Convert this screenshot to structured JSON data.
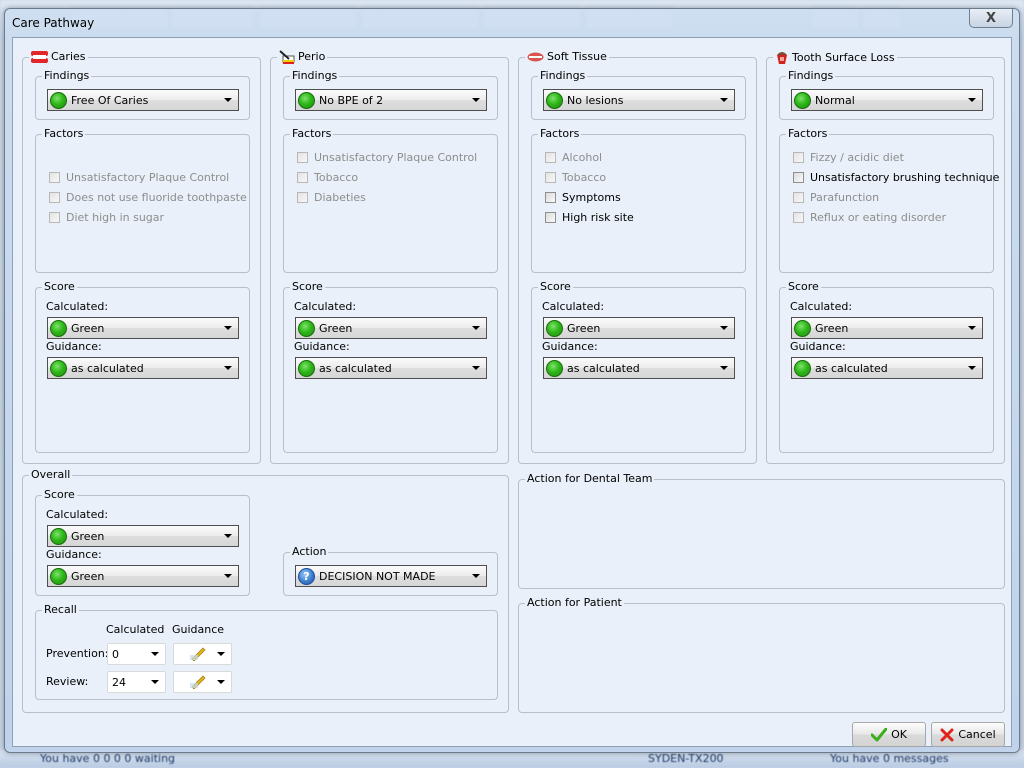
{
  "background": {
    "status_left": "You have 0 0 0 0 waiting",
    "status_mid": "SYDEN-TX200",
    "status_right": "You have 0 messages"
  },
  "dialog": {
    "title": "Care Pathway",
    "close_glyph": "X"
  },
  "sections": [
    {
      "title": "Caries",
      "icon": "dentures-icon",
      "findings_label": "Findings",
      "findings_value": "Free Of Caries",
      "factors_label": "Factors",
      "factors": [
        {
          "label": "Unsatisfactory Plaque Control",
          "checked": false,
          "enabled": false
        },
        {
          "label": "Does not use fluoride toothpaste",
          "checked": false,
          "enabled": false
        },
        {
          "label": "Diet high in sugar",
          "checked": false,
          "enabled": false
        }
      ],
      "score_label": "Score",
      "calculated_label": "Calculated:",
      "calculated_value": "Green",
      "guidance_label": "Guidance:",
      "guidance_value": "as calculated"
    },
    {
      "title": "Perio",
      "icon": "perio-probe-icon",
      "findings_label": "Findings",
      "findings_value": "No BPE of 2",
      "factors_label": "Factors",
      "factors": [
        {
          "label": "Unsatisfactory Plaque Control",
          "checked": false,
          "enabled": false
        },
        {
          "label": "Tobacco",
          "checked": false,
          "enabled": false
        },
        {
          "label": "Diabeties",
          "checked": false,
          "enabled": false
        }
      ],
      "score_label": "Score",
      "calculated_label": "Calculated:",
      "calculated_value": "Green",
      "guidance_label": "Guidance:",
      "guidance_value": "as calculated"
    },
    {
      "title": "Soft Tissue",
      "icon": "lips-icon",
      "findings_label": "Findings",
      "findings_value": "No lesions",
      "factors_label": "Factors",
      "factors": [
        {
          "label": "Alcohol",
          "checked": false,
          "enabled": false
        },
        {
          "label": "Tobacco",
          "checked": false,
          "enabled": false
        },
        {
          "label": "Symptoms",
          "checked": false,
          "enabled": true
        },
        {
          "label": "High risk site",
          "checked": false,
          "enabled": true
        }
      ],
      "score_label": "Score",
      "calculated_label": "Calculated:",
      "calculated_value": "Green",
      "guidance_label": "Guidance:",
      "guidance_value": "as calculated"
    },
    {
      "title": "Tooth Surface Loss",
      "icon": "worn-tooth-icon",
      "findings_label": "Findings",
      "findings_value": "Normal",
      "factors_label": "Factors",
      "factors": [
        {
          "label": "Fizzy / acidic diet",
          "checked": false,
          "enabled": false
        },
        {
          "label": "Unsatisfactory brushing technique",
          "checked": false,
          "enabled": true
        },
        {
          "label": "Parafunction",
          "checked": false,
          "enabled": false
        },
        {
          "label": "Reflux or eating disorder",
          "checked": false,
          "enabled": false
        }
      ],
      "score_label": "Score",
      "calculated_label": "Calculated:",
      "calculated_value": "Green",
      "guidance_label": "Guidance:",
      "guidance_value": "as calculated"
    }
  ],
  "overall": {
    "title": "Overall",
    "score_label": "Score",
    "calculated_label": "Calculated:",
    "calculated_value": "Green",
    "guidance_label": "Guidance:",
    "guidance_value": "Green",
    "action_label": "Action",
    "action_value": "DECISION NOT MADE",
    "recall": {
      "title": "Recall",
      "col_calculated": "Calculated",
      "col_guidance": "Guidance",
      "rows": [
        {
          "label": "Prevention:",
          "calculated": "0"
        },
        {
          "label": "Review:",
          "calculated": "24"
        }
      ]
    }
  },
  "action_dental_team": {
    "title": "Action for Dental Team",
    "text": ""
  },
  "action_patient": {
    "title": "Action for Patient",
    "text": ""
  },
  "buttons": {
    "ok": "OK",
    "cancel": "Cancel"
  },
  "colors": {
    "status_green": "#2fb81a",
    "dialog_bg": "#e9f0f9",
    "ok_check": "#3cae1b",
    "cancel_x": "#e0231a"
  }
}
